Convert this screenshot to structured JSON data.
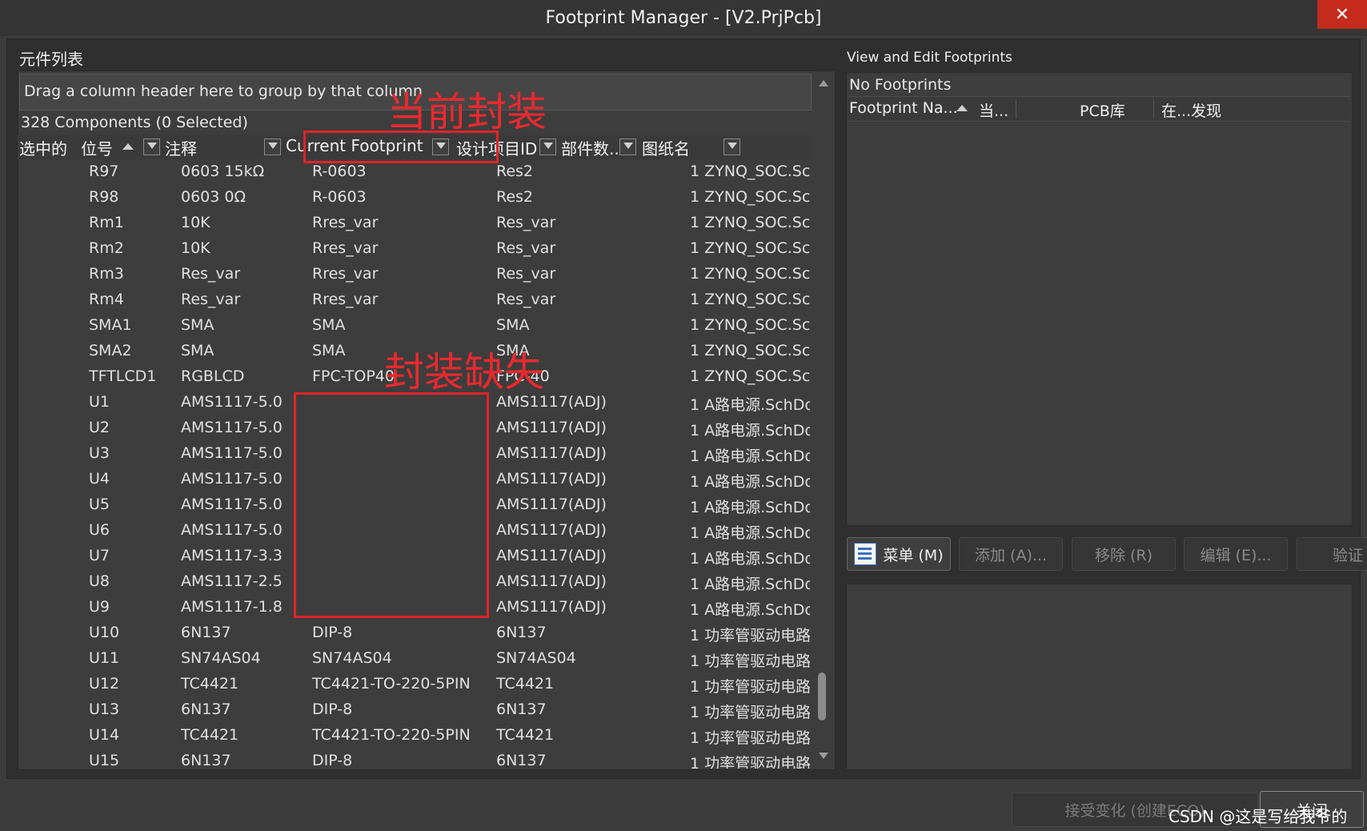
{
  "window": {
    "title": "Footprint Manager - [V2.PrjPcb]",
    "close_glyph": "✕"
  },
  "left": {
    "caption": "元件列表",
    "group_hint": "Drag a column header here to group by that column",
    "count_text": "328 Components (0 Selected)",
    "columns": [
      "选中的",
      "位号",
      "注释",
      "Current Footprint",
      "设计项目ID",
      "部件数...",
      "图纸名"
    ],
    "rows": [
      {
        "designator": "R97",
        "comment": "0603 15kΩ",
        "footprint": "R-0603",
        "design_id": "Res2",
        "parts": "1",
        "sheet": "ZYNQ_SOC.SchD"
      },
      {
        "designator": "R98",
        "comment": "0603 0Ω",
        "footprint": "R-0603",
        "design_id": "Res2",
        "parts": "1",
        "sheet": "ZYNQ_SOC.SchD"
      },
      {
        "designator": "Rm1",
        "comment": "10K",
        "footprint": "Rres_var",
        "design_id": "Res_var",
        "parts": "1",
        "sheet": "ZYNQ_SOC.SchD"
      },
      {
        "designator": "Rm2",
        "comment": "10K",
        "footprint": "Rres_var",
        "design_id": "Res_var",
        "parts": "1",
        "sheet": "ZYNQ_SOC.SchD"
      },
      {
        "designator": "Rm3",
        "comment": "Res_var",
        "footprint": "Rres_var",
        "design_id": "Res_var",
        "parts": "1",
        "sheet": "ZYNQ_SOC.SchD"
      },
      {
        "designator": "Rm4",
        "comment": "Res_var",
        "footprint": "Rres_var",
        "design_id": "Res_var",
        "parts": "1",
        "sheet": "ZYNQ_SOC.SchD"
      },
      {
        "designator": "SMA1",
        "comment": "SMA",
        "footprint": "SMA",
        "design_id": "SMA",
        "parts": "1",
        "sheet": "ZYNQ_SOC.SchD"
      },
      {
        "designator": "SMA2",
        "comment": "SMA",
        "footprint": "SMA",
        "design_id": "SMA",
        "parts": "1",
        "sheet": "ZYNQ_SOC.SchD"
      },
      {
        "designator": "TFTLCD1",
        "comment": "RGBLCD",
        "footprint": "FPC-TOP40",
        "design_id": "FPC-40",
        "parts": "1",
        "sheet": "ZYNQ_SOC.SchD"
      },
      {
        "designator": "U1",
        "comment": "AMS1117-5.0",
        "footprint": "",
        "design_id": "AMS1117(ADJ)",
        "parts": "1",
        "sheet": "A路电源.SchDoc"
      },
      {
        "designator": "U2",
        "comment": "AMS1117-5.0",
        "footprint": "",
        "design_id": "AMS1117(ADJ)",
        "parts": "1",
        "sheet": "A路电源.SchDoc"
      },
      {
        "designator": "U3",
        "comment": "AMS1117-5.0",
        "footprint": "",
        "design_id": "AMS1117(ADJ)",
        "parts": "1",
        "sheet": "A路电源.SchDoc"
      },
      {
        "designator": "U4",
        "comment": "AMS1117-5.0",
        "footprint": "",
        "design_id": "AMS1117(ADJ)",
        "parts": "1",
        "sheet": "A路电源.SchDoc"
      },
      {
        "designator": "U5",
        "comment": "AMS1117-5.0",
        "footprint": "",
        "design_id": "AMS1117(ADJ)",
        "parts": "1",
        "sheet": "A路电源.SchDoc"
      },
      {
        "designator": "U6",
        "comment": "AMS1117-5.0",
        "footprint": "",
        "design_id": "AMS1117(ADJ)",
        "parts": "1",
        "sheet": "A路电源.SchDoc"
      },
      {
        "designator": "U7",
        "comment": "AMS1117-3.3",
        "footprint": "",
        "design_id": "AMS1117(ADJ)",
        "parts": "1",
        "sheet": "A路电源.SchDoc"
      },
      {
        "designator": "U8",
        "comment": "AMS1117-2.5",
        "footprint": "",
        "design_id": "AMS1117(ADJ)",
        "parts": "1",
        "sheet": "A路电源.SchDoc"
      },
      {
        "designator": "U9",
        "comment": "AMS1117-1.8",
        "footprint": "",
        "design_id": "AMS1117(ADJ)",
        "parts": "1",
        "sheet": "A路电源.SchDoc"
      },
      {
        "designator": "U10",
        "comment": "6N137",
        "footprint": "DIP-8",
        "design_id": "6N137",
        "parts": "1",
        "sheet": "功率管驱动电路"
      },
      {
        "designator": "U11",
        "comment": "SN74AS04",
        "footprint": "SN74AS04",
        "design_id": "SN74AS04",
        "parts": "1",
        "sheet": "功率管驱动电路"
      },
      {
        "designator": "U12",
        "comment": "TC4421",
        "footprint": "TC4421-TO-220-5PIN",
        "design_id": "TC4421",
        "parts": "1",
        "sheet": "功率管驱动电路"
      },
      {
        "designator": "U13",
        "comment": "6N137",
        "footprint": "DIP-8",
        "design_id": "6N137",
        "parts": "1",
        "sheet": "功率管驱动电路"
      },
      {
        "designator": "U14",
        "comment": "TC4421",
        "footprint": "TC4421-TO-220-5PIN",
        "design_id": "TC4421",
        "parts": "1",
        "sheet": "功率管驱动电路"
      },
      {
        "designator": "U15",
        "comment": "6N137",
        "footprint": "DIP-8",
        "design_id": "6N137",
        "parts": "1",
        "sheet": "功率管驱动电路"
      }
    ]
  },
  "annotations": {
    "current_footprint_label": "当前封装",
    "missing_footprint_label": "封装缺失",
    "color": "#e0242a"
  },
  "right": {
    "caption": "View and Edit Footprints",
    "empty_text": "No Footprints",
    "columns": [
      "Footprint Na...",
      "当...",
      "PCB库",
      "在...发现"
    ],
    "buttons": {
      "menu": "菜单 (M)",
      "add": "添加 (A)...",
      "remove": "移除 (R)",
      "edit": "编辑 (E)...",
      "validate": "验证"
    }
  },
  "footer": {
    "accept": "接受变化 (创建ECO)",
    "close": "关闭",
    "watermark": "CSDN @这是写给我爷的"
  }
}
